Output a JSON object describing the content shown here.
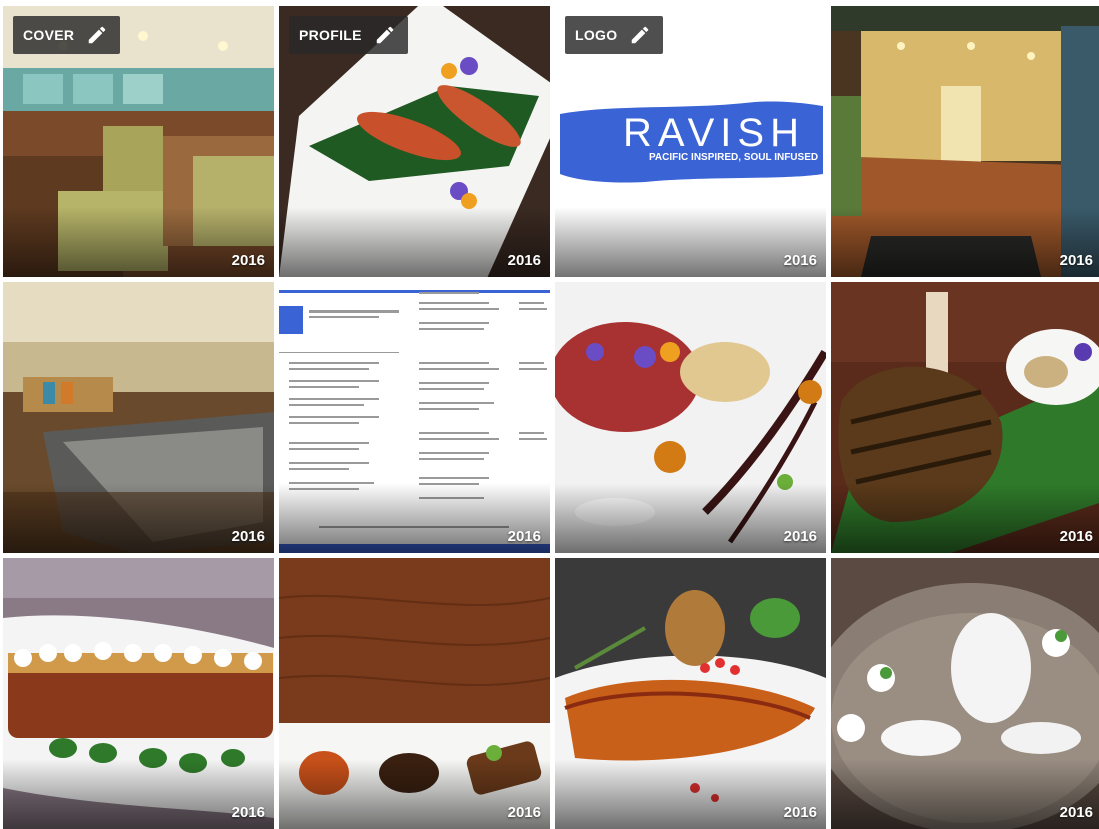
{
  "gallery": {
    "tiles": [
      {
        "badge": "COVER",
        "year": "2016"
      },
      {
        "badge": "PROFILE",
        "year": "2016"
      },
      {
        "badge": "LOGO",
        "year": "2016",
        "logo_name": "RAVISH",
        "logo_tagline": "PACIFIC INSPIRED, SOUL INFUSED"
      },
      {
        "year": "2016"
      },
      {
        "year": "2016"
      },
      {
        "year": "2016"
      },
      {
        "year": "2016"
      },
      {
        "year": "2016"
      },
      {
        "year": "2016"
      },
      {
        "year": "2016"
      },
      {
        "year": "2016"
      },
      {
        "year": "2016"
      }
    ]
  },
  "icons": {
    "edit": "pencil-icon"
  },
  "colors": {
    "badge_bg": "#2a2a2a",
    "logo_blue": "#3a63d6",
    "text_white": "#ffffff"
  }
}
